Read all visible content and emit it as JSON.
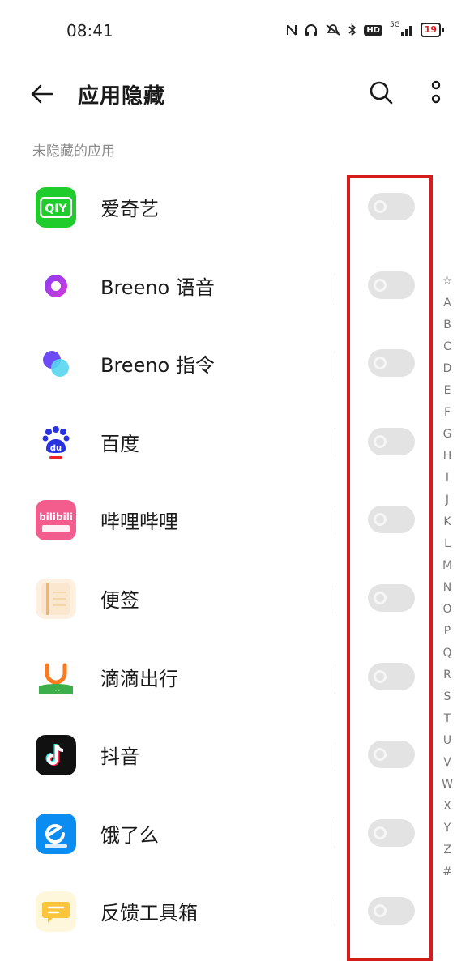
{
  "status_bar": {
    "time": "08:41",
    "icons": [
      "nfc-icon",
      "headphones-icon",
      "mute-icon",
      "bluetooth-icon",
      "hd-icon",
      "signal-icon",
      "battery-icon"
    ],
    "hd_label": "HD",
    "network": "5G",
    "battery": "19"
  },
  "header": {
    "title": "应用隐藏"
  },
  "section": {
    "title": "未隐藏的应用"
  },
  "apps": [
    {
      "name": "爱奇艺",
      "icon": "iqiyi-icon",
      "enabled": false
    },
    {
      "name": "Breeno 语音",
      "icon": "breeno-voice-icon",
      "enabled": false
    },
    {
      "name": "Breeno 指令",
      "icon": "breeno-command-icon",
      "enabled": false
    },
    {
      "name": "百度",
      "icon": "baidu-icon",
      "enabled": false
    },
    {
      "name": "哔哩哔哩",
      "icon": "bilibili-icon",
      "enabled": false
    },
    {
      "name": "便签",
      "icon": "notes-icon",
      "enabled": false
    },
    {
      "name": "滴滴出行",
      "icon": "didi-icon",
      "enabled": false
    },
    {
      "name": "抖音",
      "icon": "douyin-icon",
      "enabled": false
    },
    {
      "name": "饿了么",
      "icon": "eleme-icon",
      "enabled": false
    },
    {
      "name": "反馈工具箱",
      "icon": "feedback-toolbox-icon",
      "enabled": false
    }
  ],
  "alphabet_index": [
    "☆",
    "A",
    "B",
    "C",
    "D",
    "E",
    "F",
    "G",
    "H",
    "I",
    "J",
    "K",
    "L",
    "M",
    "N",
    "O",
    "P",
    "Q",
    "R",
    "S",
    "T",
    "U",
    "V",
    "W",
    "X",
    "Y",
    "Z",
    "#"
  ],
  "colors": {
    "highlight": "#d41c1c",
    "toggle_off": "#e3e3e3",
    "iqiyi": "#1ecd2c",
    "bilibili": "#f25d8e",
    "eleme": "#0a8cf0"
  }
}
